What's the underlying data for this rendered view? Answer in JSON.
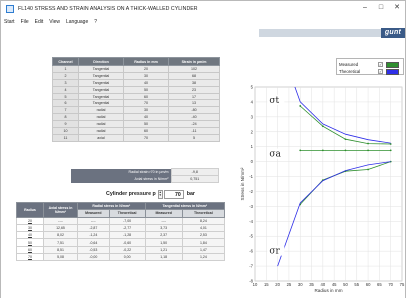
{
  "window": {
    "title": "FL140 STRESS AND STRAIN ANALYSIS ON A THICK-WALLED CYLINDER",
    "minimize": "–",
    "maximize": "□",
    "close": "✕"
  },
  "menu": [
    "Start",
    "File",
    "Edit",
    "View",
    "Language",
    "?"
  ],
  "brand": "gunt",
  "gauges": {
    "headers": [
      "Channel",
      "Direction",
      "Radius in mm",
      "Strain in µm/m"
    ],
    "rows": [
      [
        "1",
        "Tangential",
        "20",
        "102"
      ],
      [
        "2",
        "Tangential",
        "30",
        "68"
      ],
      [
        "3",
        "Tangential",
        "40",
        "38"
      ],
      [
        "4",
        "Tangential",
        "50",
        "23"
      ],
      [
        "5",
        "Tangential",
        "60",
        "17"
      ],
      [
        "6",
        "Tangential",
        "70",
        "13"
      ],
      [
        "7",
        "radial",
        "30",
        "-80"
      ],
      [
        "8",
        "radial",
        "40",
        "-40"
      ],
      [
        "9",
        "radial",
        "50",
        "-24"
      ],
      [
        "10",
        "radial",
        "60",
        "-11"
      ],
      [
        "11",
        "axial",
        "70",
        "5"
      ]
    ]
  },
  "summary": {
    "radial_strain_label": "Radial strain r70 in µm/m",
    "radial_strain_value": "-9,8",
    "axial_stress_label": "Axial stress in N/mm²",
    "axial_stress_value": "0,751"
  },
  "pressure": {
    "label": "Cylinder pressure p",
    "value": "70",
    "unit": "bar",
    "spin_up": "▲",
    "spin_down": "▼"
  },
  "stress_table": {
    "headers": [
      "Radius",
      "Axial stress in N/mm²",
      "Radial stress in N/mm²",
      "Tangential stress in N/mm²"
    ],
    "subheaders": [
      "Measured",
      "Theoretical",
      "Measured",
      "Theoretical"
    ],
    "rows": [
      [
        "20",
        "----",
        "----",
        "-7,00",
        "----",
        "8,24"
      ],
      [
        "30",
        "12,65",
        "-2,87",
        "-2,77",
        "3,73",
        "4,01"
      ],
      [
        "40",
        "8,02",
        "-1,24",
        "-1,28",
        "2,37",
        "2,53"
      ],
      [
        "50",
        "7,51",
        "-0,64",
        "-0,60",
        "1,50",
        "1,84"
      ],
      [
        "60",
        "8,51",
        "-0,53",
        "-0,22",
        "1,21",
        "1,47"
      ],
      [
        "70",
        "5,08",
        "-0,00",
        "0,00",
        "1,18",
        "1,24"
      ]
    ]
  },
  "legend": {
    "measured_label": "Measured",
    "theoretical_label": "Theoretical",
    "measured_check": "✓",
    "theoretical_check": "✓"
  },
  "chart_data": {
    "type": "line",
    "xlabel": "Radius in mm",
    "ylabel": "Stress in N/mm²",
    "xlim": [
      10,
      75
    ],
    "ylim": [
      -8,
      5
    ],
    "xticks": [
      10,
      15,
      20,
      25,
      30,
      35,
      40,
      45,
      50,
      55,
      60,
      65,
      70,
      75
    ],
    "yticks": [
      -8,
      -7,
      -6,
      -5,
      -4,
      -3,
      -2,
      -1,
      0,
      1,
      2,
      3,
      4,
      5
    ],
    "grid": true,
    "colors": {
      "measured": "#2f8f2f",
      "theoretical": "#2f2fe8"
    },
    "annotations": [
      {
        "text": "σt",
        "x": 19,
        "y": 4
      },
      {
        "text": "σa",
        "x": 19,
        "y": 0.4
      },
      {
        "text": "σr",
        "x": 19,
        "y": -6.1
      }
    ],
    "series": [
      {
        "name": "Measured",
        "x": [
          30,
          40,
          50,
          60,
          70
        ],
        "y": [
          3.73,
          2.37,
          1.5,
          1.21,
          1.18
        ]
      },
      {
        "name": "Theoretical",
        "x": [
          20,
          30,
          40,
          50,
          60,
          70
        ],
        "y": [
          8.24,
          4.01,
          2.53,
          1.84,
          1.47,
          1.24
        ]
      },
      {
        "name": "Measured",
        "x": [
          30,
          40,
          50,
          60,
          70
        ],
        "y": [
          0.751,
          0.751,
          0.751,
          0.751,
          0.751
        ]
      },
      {
        "name": "Measured",
        "x": [
          30,
          40,
          50,
          60,
          70
        ],
        "y": [
          -2.87,
          -1.24,
          -0.64,
          -0.53,
          -0.0
        ]
      },
      {
        "name": "Theoretical",
        "x": [
          20,
          30,
          40,
          50,
          60,
          70
        ],
        "y": [
          -7.0,
          -2.77,
          -1.28,
          -0.6,
          -0.22,
          0.0
        ]
      }
    ]
  }
}
